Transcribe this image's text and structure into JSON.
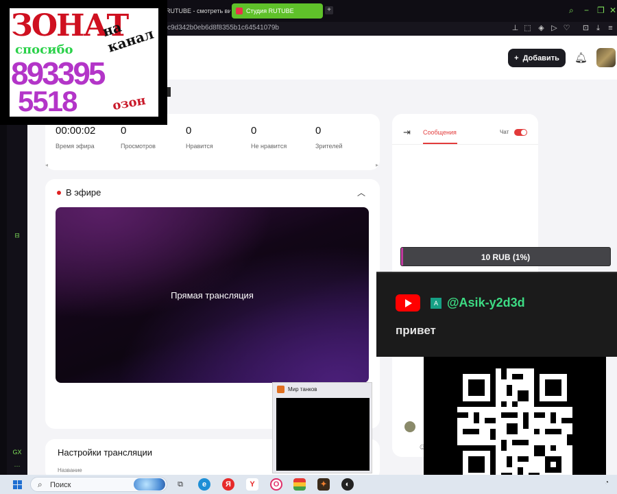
{
  "browser": {
    "tabs": [
      {
        "label": "RUTUBE - смотреть виде"
      },
      {
        "label": "Студия RUTUBE"
      }
    ],
    "new_tab": "+",
    "url": "c9d342b0eb6d8f8355b1c64541079b",
    "sidebar_gx": "GX",
    "sidebar_more": "···"
  },
  "header": {
    "add_label": "Добавить",
    "add_icon": "+"
  },
  "stats": [
    {
      "value": "00:00:02",
      "label": "Время эфира"
    },
    {
      "value": "0",
      "label": "Просмотров"
    },
    {
      "value": "0",
      "label": "Нравится"
    },
    {
      "value": "0",
      "label": "Не нравится"
    },
    {
      "value": "0",
      "label": "Зрителей"
    }
  ],
  "live": {
    "title": "В эфире",
    "player_text": "Прямая трансляция"
  },
  "settings": {
    "title": "Настройки трансляции",
    "field_label": "Название"
  },
  "chat": {
    "tab_messages": "Сообщения",
    "chat_toggle_label": "Чат"
  },
  "overlays": {
    "donation": {
      "line1": "ЗОНАТ",
      "line2": "на канал",
      "line3": "спосибо",
      "line4": "893395",
      "line5": "5518",
      "line6": "озон"
    },
    "goal": {
      "text": "10 RUB (1%)",
      "progress_percent": 1
    },
    "youtube_chat": {
      "badge": "A",
      "username": "@Asik-y2d3d",
      "message": "привет"
    }
  },
  "taskbar": {
    "search_placeholder": "Поиск",
    "preview_title": "Мир танков"
  },
  "colors": {
    "accent_red": "#e23b3b",
    "browser_green": "#5fc12a",
    "goal_fill": "#c23aa0",
    "yt_username": "#3ddc84"
  }
}
